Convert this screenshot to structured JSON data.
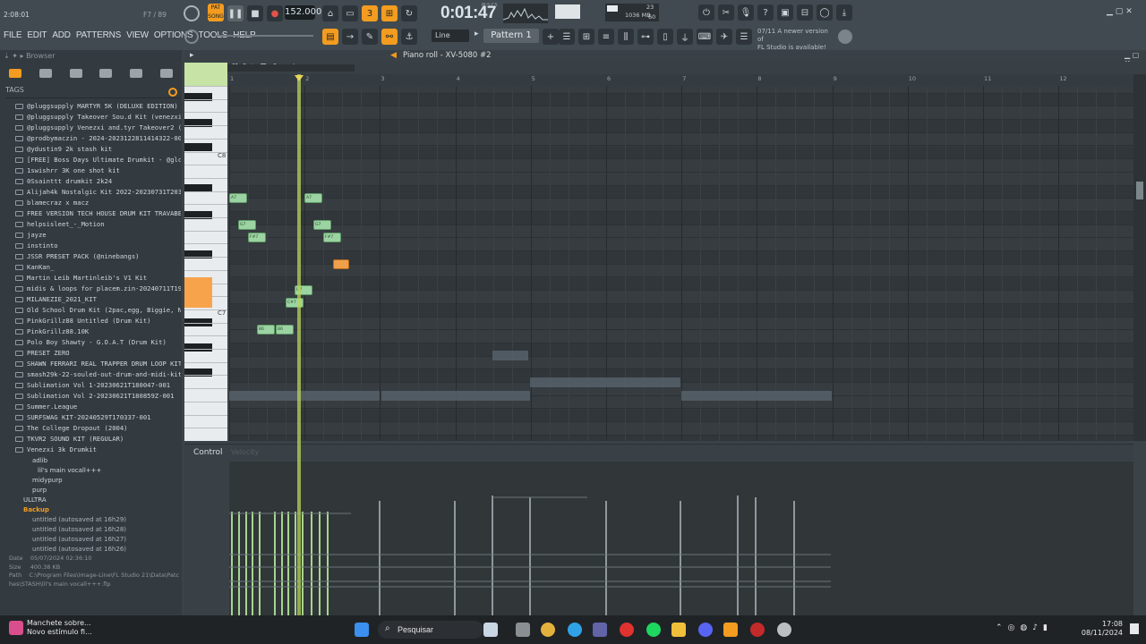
{
  "top": {
    "hint_left": "2:08:01",
    "pattern_counter": "F7 / 89",
    "bpm": "152.000",
    "time": "0:01:47",
    "time_ms": "M:S:CS",
    "cpu": "23",
    "mem": "1036 MB",
    "polyphony": "60",
    "pattern": "Pattern 1",
    "snap": "Line",
    "hint_line1": "07/11 A newer version of",
    "hint_line2": "FL Studio is available!"
  },
  "menu": [
    "FILE",
    "EDIT",
    "ADD",
    "PATTERNS",
    "VIEW",
    "OPTIONS",
    "TOOLS",
    "HELP"
  ],
  "browser": {
    "title": "Browser",
    "tags_label": "TAGS",
    "folders": [
      "@pluggsupply MARTYR 5K (DELUXE EDITION)",
      "@pluggsupply Takeover Sou.d Kit (venezxi x 1martyr)",
      "@pluggsupply Venezxi and.tyr Takeover2 (Sound Kit)",
      "@prodbymaczin - 2024-2023122811414322-001",
      "@ydustin9 2k stash kit",
      "[FREE] Boss Days Ultimate Drumkit - @glcknobeat_",
      "1swishrr 3K one shot kit",
      "0Ssainttt drumkit 2k24",
      "Alijah4k Nostalgic Kit 2022-20230731T203657Z-001",
      "blamecraz x macz",
      "FREE VERSION TECH HOUSE DRUM KIT TRAVABEATS",
      "helpsisleet_-_Motion",
      "jayze",
      "instinto",
      "JSSR PRESET PACK (@ninebangs)",
      "KanKan_",
      "Martin Leib Martinleib's V1 Kit",
      "midis & loops for placem.zin-20240711T193039Z-001",
      "MILANEZIE_2021_KIT",
      "Old School Drum Kit (2pac,egg, Biggie, Nas, J Cole)",
      "PinkGrillz88 Untitled (Drum Kit)",
      "PinkGrillz88.10K",
      "Polo Boy Shawty - G.O.A.T (Drum Kit)",
      "PRESET ZERO",
      "SHAWN FERRARI REAL TRAPPER DRUM LOOP KIT",
      "smash29k-22-souled-out-drum-and-midi-kit_183575",
      "Sublimation Vol 1-20230621T180047-001",
      "Sublimation Vol 2-20230621T180859Z-001",
      "Summer.League",
      "SURFSWAG KIT-20240529T170337-001",
      "The College Dropout (2004)",
      "TKVR2 SOUND KIT (REGULAR)",
      "Venezxi 3k Drumkit"
    ],
    "sub_items": [
      "adlib",
      "lil's main vocall+++",
      "midypurp",
      "purp",
      "ULLTRA",
      "Backup",
      "untitled (autosaved at 16h29)",
      "untitled (autosaved at 16h28)",
      "untitled (autosaved at 16h27)",
      "untitled (autosaved at 16h26)"
    ],
    "meta_date_label": "Date",
    "meta_date": "05/07/2024 02:36:10",
    "meta_size_label": "Size",
    "meta_size": "400.38 KB",
    "meta_path_label": "Path",
    "meta_path": "C:\\Program Files\\Image-Line\\FL Studio 21\\Data\\Patches\\STASH\\lil's main vocall+++.flp"
  },
  "pianoroll": {
    "title": "Piano roll - XV-5080 #2",
    "ruler": [
      "1",
      "2",
      "3",
      "4",
      "5",
      "6",
      "7",
      "8",
      "9",
      "10",
      "11",
      "12"
    ],
    "key_c8": "C8",
    "key_c7": "C7",
    "control": "Control",
    "velocity": "Velocity"
  },
  "notes": [
    {
      "label": "A7"
    },
    {
      "label": "A7"
    },
    {
      "label": "G7"
    },
    {
      "label": "G7"
    },
    {
      "label": "F#7"
    },
    {
      "label": "F#7"
    },
    {
      "label": "D7"
    },
    {
      "label": "C#7"
    },
    {
      "label": "B6"
    },
    {
      "label": "B6"
    }
  ],
  "taskbar": {
    "news1": "Manchete sobre...",
    "news2": "Novo estímulo fi...",
    "search": "Pesquisar",
    "time": "17:08",
    "date": "08/11/2024"
  },
  "colors": {
    "accent": "#f39c1f",
    "note": "#9cd3a2",
    "playhead": "#b9d35a"
  }
}
